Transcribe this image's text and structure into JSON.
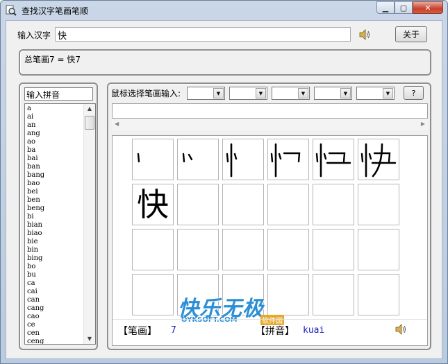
{
  "window": {
    "title": "查找汉字笔画笔顺"
  },
  "top": {
    "input_label": "输入汉字",
    "input_value": "快",
    "about_label": "关于"
  },
  "summary": {
    "text": "总笔画7 = 快7"
  },
  "pinyin_panel": {
    "input_value": "输入拼音",
    "items": [
      "a",
      "ai",
      "an",
      "ang",
      "ao",
      "ba",
      "bai",
      "ban",
      "bang",
      "bao",
      "bei",
      "ben",
      "beng",
      "bi",
      "bian",
      "biao",
      "bie",
      "bin",
      "bing",
      "bo",
      "bu",
      "ca",
      "cai",
      "can",
      "cang",
      "cao",
      "ce",
      "cen",
      "ceng"
    ]
  },
  "stroke_panel": {
    "mouse_label": "鼠标选择笔画输入:",
    "help_label": "?",
    "grid_rows": [
      [
        "1",
        "2",
        "3",
        "4",
        "5",
        "6"
      ],
      [
        "7",
        "",
        "",
        "",
        "",
        ""
      ],
      [
        "",
        "",
        "",
        "",
        "",
        ""
      ],
      [
        "",
        "",
        "",
        "",
        "",
        ""
      ]
    ],
    "final_char": "快"
  },
  "footer": {
    "stroke_label": "【笔画】",
    "stroke_value": "7",
    "pinyin_label": "【拼音】",
    "pinyin_value": "kuai"
  },
  "watermark": {
    "logo_text": "快乐无极",
    "site": "OYKSOFT.COM",
    "tag": "软件园"
  },
  "colors": {
    "accent": "#1d1dbe",
    "watermark": "#2c8fd6"
  }
}
